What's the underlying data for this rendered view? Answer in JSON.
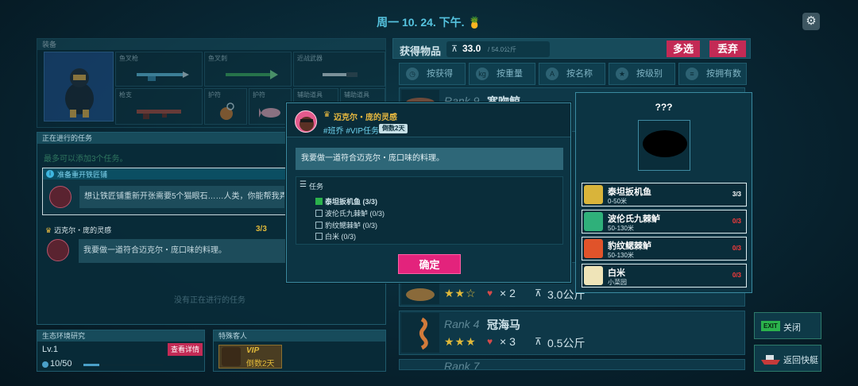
{
  "topbar": {
    "title": "周一 10. 24. 下午.",
    "title_icon": "🍍",
    "settings_icon": "⚙"
  },
  "equipment": {
    "header": "装备",
    "slots": [
      {
        "label": "鱼叉枪"
      },
      {
        "label": "鱼叉刺"
      },
      {
        "label": "近战武器"
      },
      {
        "label": "枪支"
      },
      {
        "label": "护符"
      },
      {
        "label": "护符"
      },
      {
        "label": "辅助道具"
      },
      {
        "label": "辅助道具"
      }
    ]
  },
  "tasks": {
    "header": "正在进行的任务",
    "limit_note": "最多可以添加3个任务。",
    "main_task_title": "准备重开铁匠铺",
    "main_task_text": "想让铁匠铺重新开张需要5个猫眼石……人类，你能帮我弄",
    "sub_task_title": "迈克尔・庞的灵感",
    "sub_task_count": "3/3",
    "sub_task_text": "我要做一道符合迈克尔・庞口味的料理。",
    "empty_note": "没有正在进行的任务"
  },
  "ecology": {
    "header": "生态环境研究",
    "level": "Lv.1",
    "detail_button": "查看详情",
    "progress": "10/50",
    "progress_fraction": 0.2
  },
  "guest": {
    "header": "特殊客人",
    "vip": "VIP",
    "days": "倒数2天"
  },
  "loot": {
    "title": "获得物品",
    "weight": "33.0",
    "capacity": "/ 54.0公斤",
    "multi_select": "多选",
    "discard": "丢弃",
    "tabs": [
      {
        "label": "按获得",
        "icon": "clock-icon",
        "glyph": "◷"
      },
      {
        "label": "按重量",
        "icon": "weight-icon",
        "glyph": "kg"
      },
      {
        "label": "按名称",
        "icon": "name-icon",
        "glyph": "A"
      },
      {
        "label": "按级别",
        "icon": "star-icon",
        "glyph": "★"
      },
      {
        "label": "按拥有数",
        "icon": "stack-icon",
        "glyph": "≡"
      }
    ],
    "fish": [
      {
        "rank": "Rank 9",
        "name": "宽吻鲸",
        "stars": "",
        "count": "",
        "weight": ""
      },
      {
        "rank": "",
        "name": "",
        "stars": "★★☆",
        "count": "× 2",
        "weight": "3.0公斤"
      },
      {
        "rank": "Rank 4",
        "name": "冠海马",
        "stars": "★★★",
        "count": "× 3",
        "weight": "0.5公斤"
      },
      {
        "rank": "Rank 7",
        "name": "",
        "stars": "",
        "count": "",
        "weight": ""
      }
    ]
  },
  "dialog": {
    "npc_name": "迈克尔・庞的灵感",
    "tags": "#班乔 #VIP任务",
    "badge": "倒数2天",
    "message": "我要做一道符合迈克尔・庞口味的料理。",
    "task_header": "任务",
    "items": [
      {
        "text": "泰坦扳机鱼 (3/3)",
        "done": true
      },
      {
        "text": "波伦氏九棘鲈 (0/3)",
        "done": false
      },
      {
        "text": "豹纹鳃棘鲈 (0/3)",
        "done": false
      },
      {
        "text": "白米 (0/3)",
        "done": false
      }
    ],
    "confirm": "确定"
  },
  "requirements": {
    "title": "???",
    "items": [
      {
        "name": "泰坦扳机鱼",
        "sub": "0-50米",
        "count": "3/3",
        "color": "#ffffff",
        "icon": "triggerfish-icon"
      },
      {
        "name": "波伦氏九棘鲈",
        "sub": "50-130米",
        "count": "0/3",
        "color": "#ff3b3b",
        "icon": "grouper-icon"
      },
      {
        "name": "豹纹鳃棘鲈",
        "sub": "50-130米",
        "count": "0/3",
        "color": "#ff3b3b",
        "icon": "coral-trout-icon"
      },
      {
        "name": "白米",
        "sub": "小菜园",
        "count": "0/3",
        "color": "#ff3b3b",
        "icon": "rice-icon"
      }
    ]
  },
  "side": {
    "exit_badge": "EXIT",
    "close": "关闭",
    "boat": "返回快艇"
  }
}
